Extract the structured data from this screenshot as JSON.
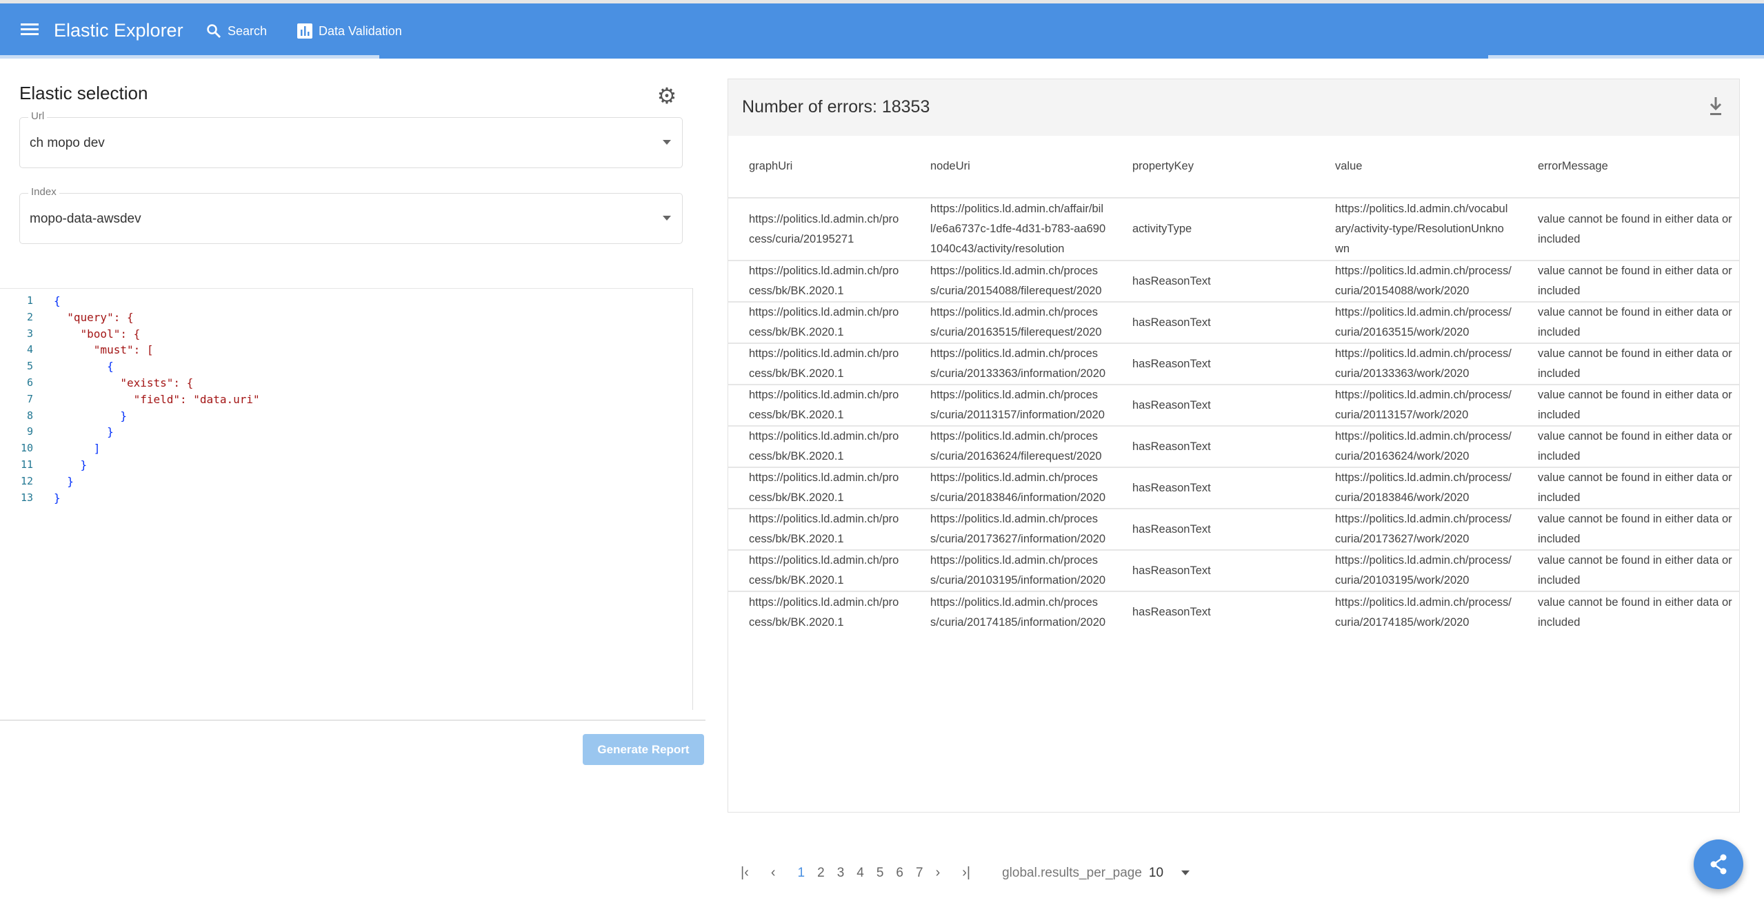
{
  "header": {
    "title": "Elastic Explorer",
    "nav": [
      {
        "label": "Search",
        "icon": "search-icon"
      },
      {
        "label": "Data Validation",
        "icon": "bar-chart-icon"
      }
    ],
    "color": "#4a90e2"
  },
  "left": {
    "title": "Elastic selection",
    "url": {
      "label": "Url",
      "value": "ch mopo dev"
    },
    "index": {
      "label": "Index",
      "value": "mopo-data-awsdev"
    },
    "query_lines": [
      "{",
      "  \"query\": {",
      "    \"bool\": {",
      "      \"must\": [",
      "        {",
      "          \"exists\": {",
      "            \"field\": \"data.uri\"",
      "          }",
      "        }",
      "      ]",
      "    }",
      "  }",
      "}"
    ],
    "generate_label": "Generate Report"
  },
  "report": {
    "title": "Number of errors: 18353",
    "columns": [
      "graphUri",
      "nodeUri",
      "propertyKey",
      "value",
      "errorMessage"
    ],
    "rows": [
      [
        "https://politics.ld.admin.ch/process/curia/20195271",
        "https://politics.ld.admin.ch/affair/bill/e6a6737c-1dfe-4d31-b783-aa6901040c43/activity/resolution",
        "activityType",
        "https://politics.ld.admin.ch/vocabulary/activity-type/ResolutionUnknown",
        "value cannot be found in either data or included"
      ],
      [
        "https://politics.ld.admin.ch/process/bk/BK.2020.1",
        "https://politics.ld.admin.ch/process/curia/20154088/filerequest/2020",
        "hasReasonText",
        "https://politics.ld.admin.ch/process/curia/20154088/work/2020",
        "value cannot be found in either data or included"
      ],
      [
        "https://politics.ld.admin.ch/process/bk/BK.2020.1",
        "https://politics.ld.admin.ch/process/curia/20163515/filerequest/2020",
        "hasReasonText",
        "https://politics.ld.admin.ch/process/curia/20163515/work/2020",
        "value cannot be found in either data or included"
      ],
      [
        "https://politics.ld.admin.ch/process/bk/BK.2020.1",
        "https://politics.ld.admin.ch/process/curia/20133363/information/2020",
        "hasReasonText",
        "https://politics.ld.admin.ch/process/curia/20133363/work/2020",
        "value cannot be found in either data or included"
      ],
      [
        "https://politics.ld.admin.ch/process/bk/BK.2020.1",
        "https://politics.ld.admin.ch/process/curia/20113157/information/2020",
        "hasReasonText",
        "https://politics.ld.admin.ch/process/curia/20113157/work/2020",
        "value cannot be found in either data or included"
      ],
      [
        "https://politics.ld.admin.ch/process/bk/BK.2020.1",
        "https://politics.ld.admin.ch/process/curia/20163624/filerequest/2020",
        "hasReasonText",
        "https://politics.ld.admin.ch/process/curia/20163624/work/2020",
        "value cannot be found in either data or included"
      ],
      [
        "https://politics.ld.admin.ch/process/bk/BK.2020.1",
        "https://politics.ld.admin.ch/process/curia/20183846/information/2020",
        "hasReasonText",
        "https://politics.ld.admin.ch/process/curia/20183846/work/2020",
        "value cannot be found in either data or included"
      ],
      [
        "https://politics.ld.admin.ch/process/bk/BK.2020.1",
        "https://politics.ld.admin.ch/process/curia/20173627/information/2020",
        "hasReasonText",
        "https://politics.ld.admin.ch/process/curia/20173627/work/2020",
        "value cannot be found in either data or included"
      ],
      [
        "https://politics.ld.admin.ch/process/bk/BK.2020.1",
        "https://politics.ld.admin.ch/process/curia/20103195/information/2020",
        "hasReasonText",
        "https://politics.ld.admin.ch/process/curia/20103195/work/2020",
        "value cannot be found in either data or included"
      ],
      [
        "https://politics.ld.admin.ch/process/bk/BK.2020.1",
        "https://politics.ld.admin.ch/process/curia/20174185/information/2020",
        "hasReasonText",
        "https://politics.ld.admin.ch/process/curia/20174185/work/2020",
        "value cannot be found in either data or included"
      ]
    ],
    "pagination": {
      "pages": [
        "1",
        "2",
        "3",
        "4",
        "5",
        "6",
        "7"
      ],
      "current": "1",
      "per_page_label": "global.results_per_page",
      "per_page": "10"
    }
  }
}
